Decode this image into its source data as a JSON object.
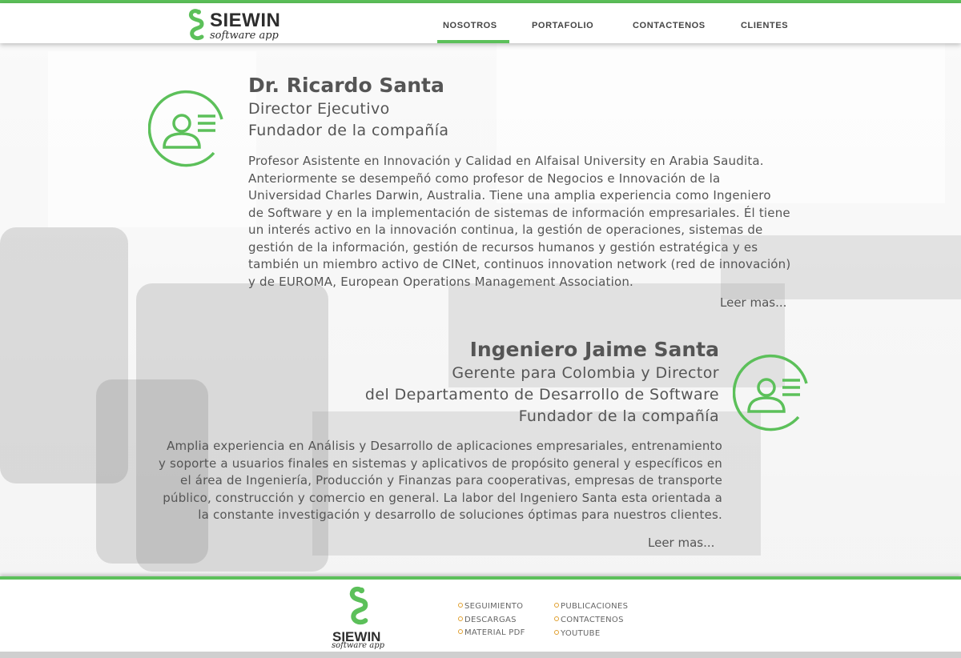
{
  "brand": {
    "name": "SIEWIN",
    "tagline": "software app"
  },
  "colors": {
    "accent": "#5cc05a",
    "text": "#555555",
    "bullet": "#e0a030"
  },
  "nav": {
    "items": [
      {
        "label": "NOSOTROS",
        "active": true
      },
      {
        "label": "PORTAFOLIO",
        "active": false
      },
      {
        "label": "CONTACTENOS",
        "active": false
      },
      {
        "label": "CLIENTES",
        "active": false
      }
    ]
  },
  "profiles": [
    {
      "name": "Dr. Ricardo Santa",
      "roles": [
        "Director Ejecutivo",
        "Fundador de la compañía"
      ],
      "bio": [
        "Profesor Asistente en Innovación y Calidad en Alfaisal University en Arabia Saudita.",
        "Anteriormente se desempeñó como profesor de Negocios e Innovación de la",
        "Universidad Charles Darwin, Australia. Tiene una amplia experiencia como Ingeniero",
        "de Software y en la implementación de sistemas de información empresariales. Él tiene",
        "un interés activo en la innovación continua, la gestión de operaciones, sistemas de",
        "gestión de la información, gestión de recursos humanos y gestión estratégica y es",
        "también un miembro activo de CINet, continuos innovation network (red de innovación)",
        "y de EUROMA, European Operations Management Association."
      ],
      "more_label": "Leer mas...",
      "icon": "user-profile-icon"
    },
    {
      "name": "Ingeniero Jaime Santa",
      "roles": [
        "Gerente para Colombia y Director",
        "del Departamento de Desarrollo de Software",
        "Fundador de la compañía"
      ],
      "bio": [
        "Amplia experiencia en Análisis y Desarrollo de aplicaciones empresariales, entrenamiento",
        "y soporte a usuarios finales en sistemas y aplicativos de propósito general  y específicos en",
        "el área de Ingeniería, Producción y Finanzas para cooperativas, empresas de transporte",
        "público, construcción y comercio en general. La labor del Ingeniero Santa esta orientada a",
        "la constante investigación y desarrollo de soluciones óptimas para nuestros clientes."
      ],
      "more_label": "Leer mas...",
      "icon": "user-profile-icon"
    }
  ],
  "footer": {
    "brand": "SIEWIN",
    "tagline": "software app",
    "links_col1": [
      "SEGUIMIENTO",
      "DESCARGAS",
      "MATERIAL PDF"
    ],
    "links_col2": [
      "PUBLICACIONES",
      "CONTACTENOS",
      "YOUTUBE"
    ]
  }
}
